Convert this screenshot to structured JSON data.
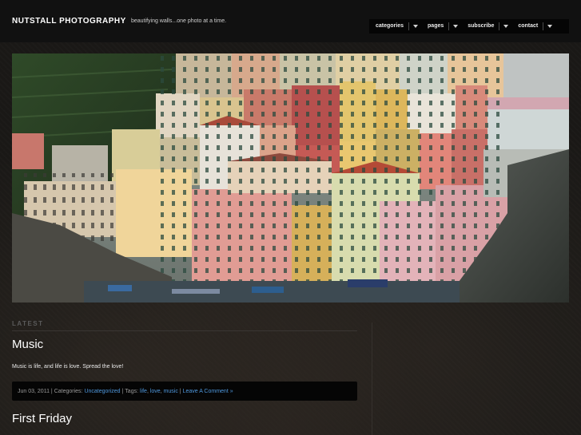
{
  "header": {
    "site_title": "NUTSTALL PHOTOGRAPHY",
    "tagline": "beautifying walls...one photo at a time."
  },
  "nav": {
    "items": [
      {
        "label": "categories"
      },
      {
        "label": "pages"
      },
      {
        "label": "subscribe"
      },
      {
        "label": "contact"
      }
    ]
  },
  "main": {
    "section_label": "LATEST",
    "posts": [
      {
        "title": "Music",
        "excerpt": "Music is life, and life is love. Spread the love!",
        "date": "Jun 03, 2011",
        "sep": " | ",
        "categories_label": "Categories: ",
        "category": "Uncategorized",
        "tags_label": "Tags: ",
        "tags": [
          "life",
          "love",
          "music"
        ],
        "tag_sep": ", ",
        "comment_link": "Leave A Comment »"
      },
      {
        "title": "First Friday"
      }
    ]
  },
  "colors": {
    "header_bg": "#111111",
    "link": "#4e97dc",
    "meta_bg": "#050505"
  }
}
